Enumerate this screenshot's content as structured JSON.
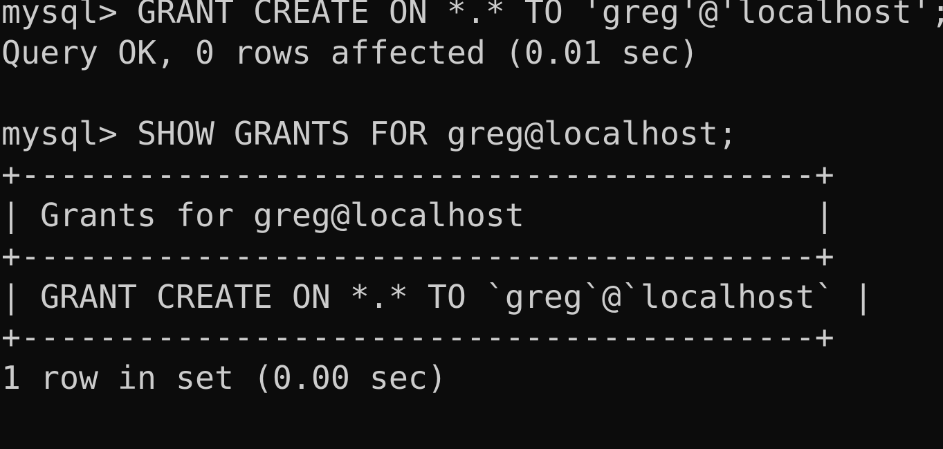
{
  "colors": {
    "background": "#0c0c0c",
    "foreground": "#cccccc"
  },
  "lines": [
    "mysql> GRANT CREATE ON *.* TO 'greg'@'localhost';",
    "Query OK, 0 rows affected (0.01 sec)",
    "",
    "mysql> SHOW GRANTS FOR greg@localhost;",
    "+-----------------------------------------+",
    "| Grants for greg@localhost               |",
    "+-----------------------------------------+",
    "| GRANT CREATE ON *.* TO `greg`@`localhost` |",
    "+-----------------------------------------+",
    "1 row in set (0.00 sec)",
    ""
  ]
}
